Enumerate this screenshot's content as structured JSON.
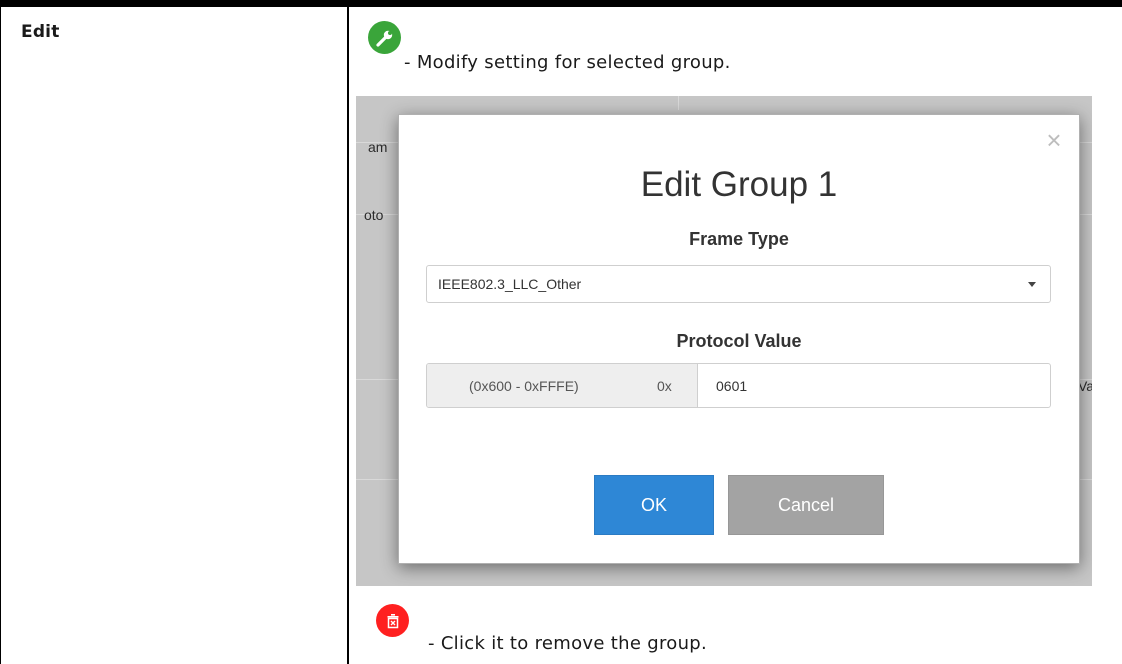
{
  "term": "Edit",
  "edit_description": "- Modify setting for selected group.",
  "delete_description": "- Click it to remove the group.",
  "icons": {
    "edit": "wrench-icon",
    "delete": "trash-icon",
    "close": "close-icon",
    "dropdown": "caret-down-icon"
  },
  "colors": {
    "edit_icon": "#3aa53a",
    "delete_icon": "#ff2020",
    "ok_button": "#2e87d6",
    "cancel_button": "#a3a3a3"
  },
  "background_fragments": {
    "frag1": "am",
    "frag2": "oto",
    "frag3": "Va"
  },
  "modal": {
    "title": "Edit Group 1",
    "close_glyph": "×",
    "frame_type": {
      "label": "Frame Type",
      "value": "IEEE802.3_LLC_Other"
    },
    "protocol_value": {
      "label": "Protocol Value",
      "range": "(0x600 - 0xFFFE)",
      "prefix": "0x",
      "value": "0601"
    },
    "buttons": {
      "ok": "OK",
      "cancel": "Cancel"
    }
  }
}
